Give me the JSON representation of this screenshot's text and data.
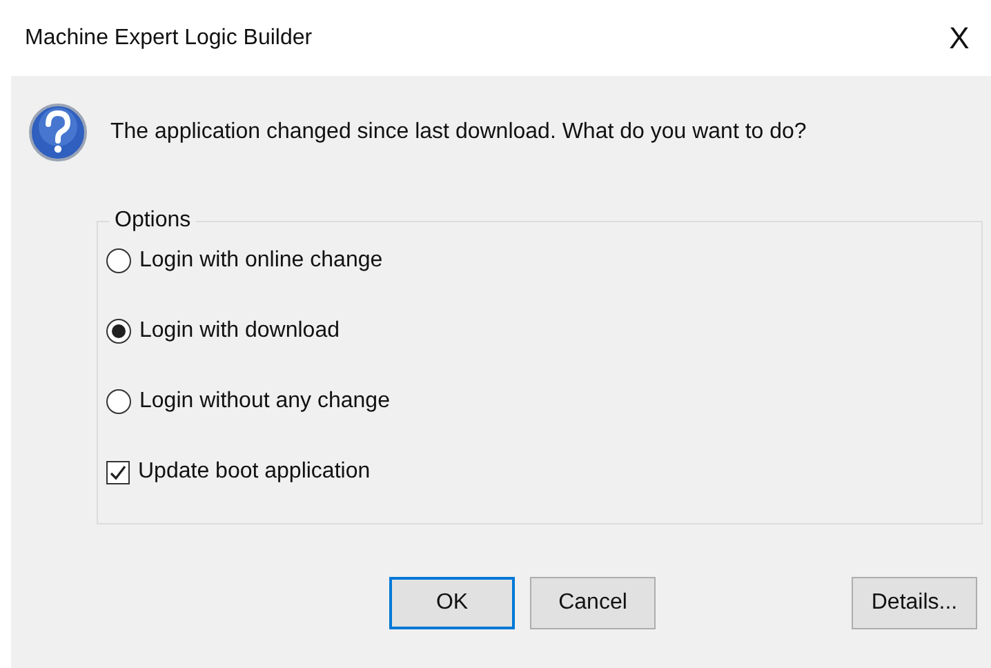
{
  "window": {
    "title": "Machine Expert Logic Builder",
    "close": "X"
  },
  "message": "The application changed since last download. What do you want to do?",
  "options": {
    "label": "Options",
    "items": [
      {
        "kind": "radio",
        "label": "Login with online change",
        "selected": false
      },
      {
        "kind": "radio",
        "label": "Login with download",
        "selected": true
      },
      {
        "kind": "radio",
        "label": "Login without any change",
        "selected": false
      },
      {
        "kind": "checkbox",
        "label": "Update boot application",
        "checked": true
      }
    ]
  },
  "buttons": [
    {
      "label": "OK",
      "default": true
    },
    {
      "label": "Cancel",
      "default": false
    }
  ],
  "details_button": {
    "label": "Details..."
  }
}
